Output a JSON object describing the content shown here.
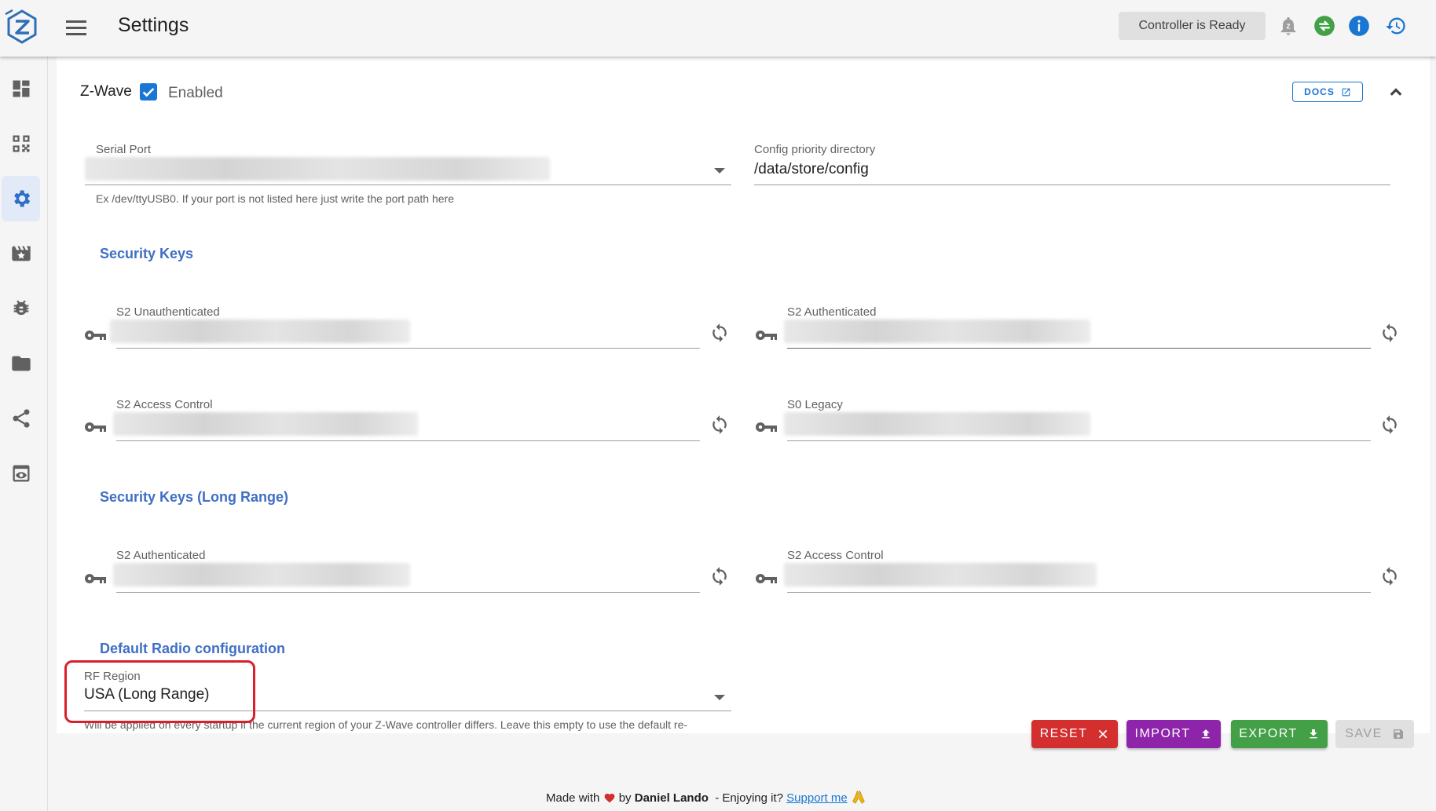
{
  "header": {
    "title": "Settings",
    "controller_status": "Controller is Ready"
  },
  "sidebar": {
    "items": [
      {
        "name": "dashboard-icon"
      },
      {
        "name": "qr-code-icon"
      },
      {
        "name": "settings-icon",
        "active": true
      },
      {
        "name": "scenes-icon"
      },
      {
        "name": "debug-icon"
      },
      {
        "name": "folder-icon"
      },
      {
        "name": "share-icon"
      },
      {
        "name": "preview-icon"
      }
    ]
  },
  "zwave": {
    "title": "Z-Wave",
    "enabled_label": "Enabled",
    "enabled": true,
    "docs_label": "DOCS"
  },
  "serial_port": {
    "label": "Serial Port",
    "hint": "Ex /dev/ttyUSB0. If your port is not listed here just write the port path here"
  },
  "config_dir": {
    "label": "Config priority directory",
    "value": "/data/store/config"
  },
  "security_keys": {
    "title": "Security Keys",
    "s2_unauth": "S2 Unauthenticated",
    "s2_auth": "S2 Authenticated",
    "s2_access": "S2 Access Control",
    "s0_legacy": "S0 Legacy"
  },
  "security_keys_lr": {
    "title": "Security Keys (Long Range)",
    "s2_auth": "S2 Authenticated",
    "s2_access": "S2 Access Control"
  },
  "radio": {
    "title": "Default Radio configuration",
    "rf_label": "RF Region",
    "rf_value": "USA (Long Range)",
    "hint": "Will be applied on every startup if the current region of your Z-Wave controller differs. Leave this empty to use the default re-"
  },
  "actions": {
    "reset": "RESET",
    "import": "IMPORT",
    "export": "EXPORT",
    "save": "SAVE"
  },
  "footer": {
    "made_with": "Made with",
    "by": "by",
    "author": "Daniel Lando",
    "enjoying": "- Enjoying it?",
    "support": "Support me"
  },
  "colors": {
    "primary": "#1976d2",
    "section_title": "#3f6fc5",
    "reset": "#d32f2f",
    "import": "#8e24aa",
    "export": "#43a047",
    "highlight": "#d91f2b"
  }
}
